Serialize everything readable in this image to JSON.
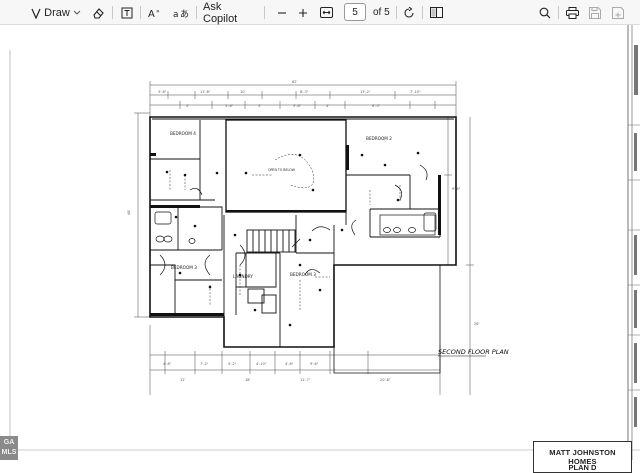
{
  "toolbar": {
    "draw_label": "Draw",
    "ask_copilot_label": "Ask Copilot",
    "current_page": "5",
    "page_total": "of 5"
  },
  "plan": {
    "room_bedroom4": "BEDROOM 4",
    "room_bedroom2": "BEDROOM 2",
    "room_bedroom3_left": "BEDROOM 3",
    "room_bedroom3_right": "BEDROOM 3",
    "room_laundry": "LAUNDRY",
    "open_to_below": "OPEN TO BELOW",
    "floor_plan_title": "SECOND FLOOR PLAN"
  },
  "title_block": {
    "company": "MATT JOHNSTON HOMES",
    "plan": "PLAN D"
  },
  "watermark": {
    "line1": "GA",
    "line2": "MLS"
  }
}
